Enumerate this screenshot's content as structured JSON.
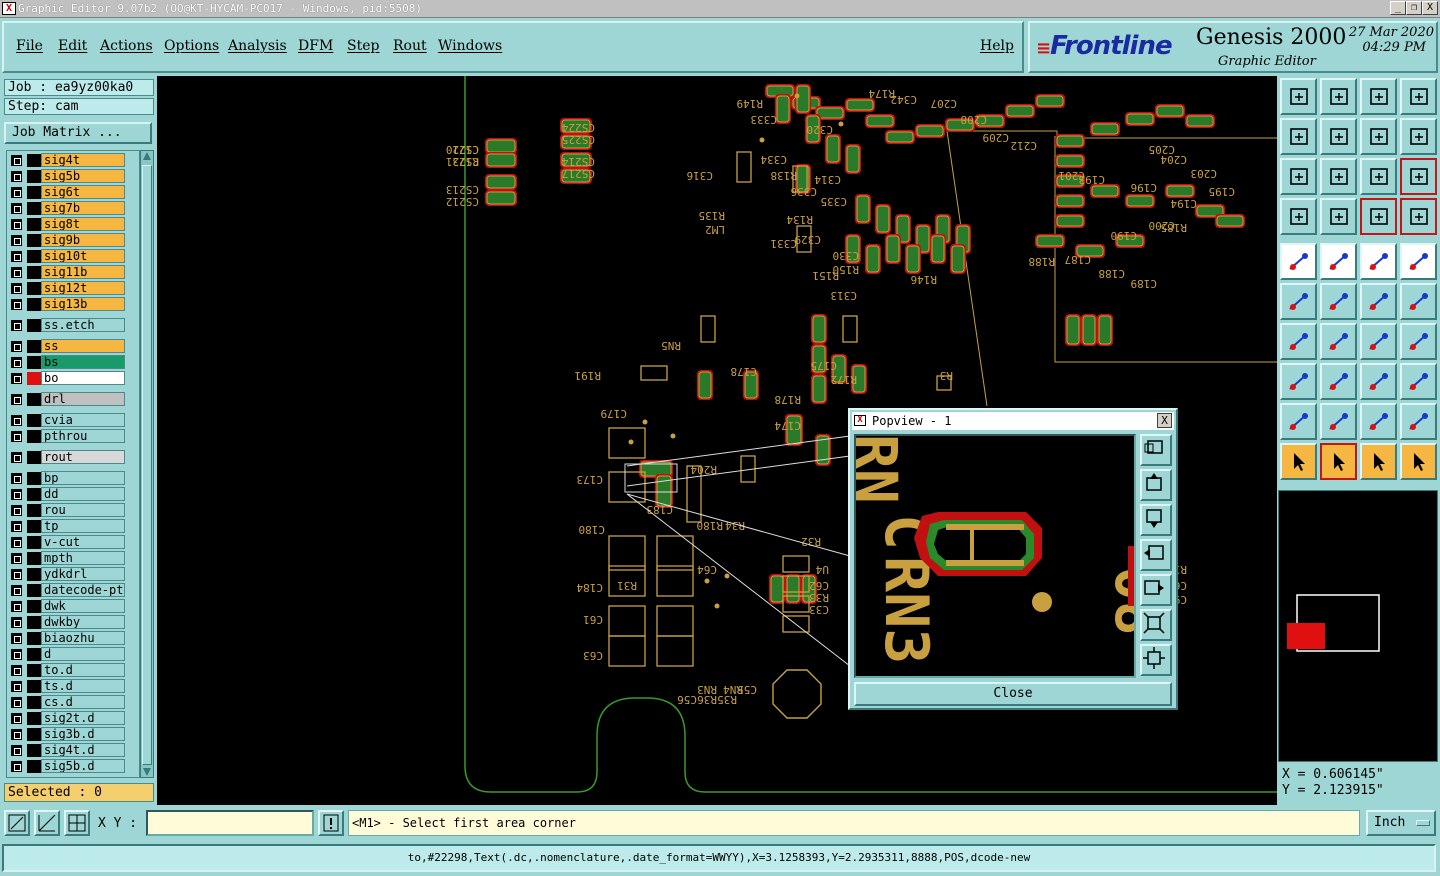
{
  "window": {
    "title": "Graphic Editor 9.07b2 (OO@KT-HYCAM-PC017 - Windows, pid:5508)",
    "buttons": [
      "_",
      "❐",
      "X"
    ]
  },
  "menu": {
    "items": [
      "File",
      "Edit",
      "Actions",
      "Options",
      "Analysis",
      "DFM",
      "Step",
      "Rout",
      "Windows"
    ],
    "help": "Help"
  },
  "brand": {
    "logo": "Frontline",
    "product": "Genesis 2000",
    "subtitle": "Graphic Editor",
    "date": "27 Mar 2020",
    "time": "04:29 PM"
  },
  "job": {
    "job_label": "Job : ea9yz00ka0",
    "step_label": "Step: cam",
    "matrix_button": "Job Matrix ..."
  },
  "layers": [
    {
      "name": "sig4t",
      "color": "#f5b642",
      "gap": 0
    },
    {
      "name": "sig5b",
      "color": "#f5b642",
      "gap": 0
    },
    {
      "name": "sig6t",
      "color": "#f5b642",
      "gap": 0
    },
    {
      "name": "sig7b",
      "color": "#f5b642",
      "gap": 0
    },
    {
      "name": "sig8t",
      "color": "#f5b642",
      "gap": 0
    },
    {
      "name": "sig9b",
      "color": "#f5b642",
      "gap": 0
    },
    {
      "name": "sig10t",
      "color": "#f5b642",
      "gap": 0
    },
    {
      "name": "sig11b",
      "color": "#f5b642",
      "gap": 0
    },
    {
      "name": "sig12t",
      "color": "#f5b642",
      "gap": 0
    },
    {
      "name": "sig13b",
      "color": "#f5b642",
      "gap": 0
    },
    {
      "name": "ss.etch",
      "color": "#9ed6d6",
      "gap": 1
    },
    {
      "name": "ss",
      "color": "#f5b642",
      "gap": 1
    },
    {
      "name": "bs",
      "color": "#1a9a6a",
      "gap": 0
    },
    {
      "name": "bo",
      "color": "#ffffff",
      "gap": 0,
      "swatch": "#e01010"
    },
    {
      "name": "drl",
      "color": "#c0c0c0",
      "gap": 1
    },
    {
      "name": "cvia",
      "color": "#9ed6d6",
      "gap": 1
    },
    {
      "name": "pthrou",
      "color": "#9ed6d6",
      "gap": 0
    },
    {
      "name": "rout",
      "color": "#d8d8d8",
      "gap": 1
    },
    {
      "name": "bp",
      "color": "#9ed6d6",
      "gap": 1
    },
    {
      "name": "dd",
      "color": "#9ed6d6",
      "gap": 0
    },
    {
      "name": "rou",
      "color": "#9ed6d6",
      "gap": 0
    },
    {
      "name": "tp",
      "color": "#9ed6d6",
      "gap": 0
    },
    {
      "name": "v-cut",
      "color": "#9ed6d6",
      "gap": 0
    },
    {
      "name": "mpth",
      "color": "#9ed6d6",
      "gap": 0
    },
    {
      "name": "ydkdrl",
      "color": "#9ed6d6",
      "gap": 0
    },
    {
      "name": "datecode-pt",
      "color": "#9ed6d6",
      "gap": 0
    },
    {
      "name": "dwk",
      "color": "#9ed6d6",
      "gap": 0
    },
    {
      "name": "dwkby",
      "color": "#9ed6d6",
      "gap": 0
    },
    {
      "name": "biaozhu",
      "color": "#9ed6d6",
      "gap": 0
    },
    {
      "name": "d",
      "color": "#9ed6d6",
      "gap": 0
    },
    {
      "name": "to.d",
      "color": "#9ed6d6",
      "gap": 0
    },
    {
      "name": "ts.d",
      "color": "#9ed6d6",
      "gap": 0
    },
    {
      "name": "cs.d",
      "color": "#9ed6d6",
      "gap": 0
    },
    {
      "name": "sig2t.d",
      "color": "#9ed6d6",
      "gap": 0
    },
    {
      "name": "sig3b.d",
      "color": "#9ed6d6",
      "gap": 0
    },
    {
      "name": "sig4t.d",
      "color": "#9ed6d6",
      "gap": 0
    },
    {
      "name": "sig5b.d",
      "color": "#9ed6d6",
      "gap": 0
    }
  ],
  "selected": "Selected : 0",
  "coords": {
    "x": "X = 0.606145\"",
    "y": "Y = 2.123915\""
  },
  "bottom": {
    "xy_label": "X Y :",
    "xy_value": "",
    "prompt": "<M1> - Select first area corner",
    "units": "Inch",
    "status": "to,#22298,Text(.dc,.nomenclature,.date_format=WWYY),X=3.1258393,Y=2.2935311,8888,POS,dcode-new"
  },
  "popview": {
    "title": "Popview - 1",
    "close": "Close",
    "close_x": "X"
  },
  "board_labels": [
    "CS220",
    "CS221",
    "CS224",
    "CS225",
    "CS214",
    "CS217",
    "CS213",
    "CS212",
    "C316",
    "R135",
    "LM2",
    "R134",
    "C331",
    "C329",
    "C330",
    "R150",
    "R151",
    "R149",
    "C333",
    "C334",
    "R138",
    "C336",
    "C335",
    "C320",
    "C314",
    "C313",
    "R146",
    "R174",
    "C342",
    "C207",
    "C208",
    "C209",
    "C212",
    "C205",
    "C204",
    "C203",
    "C195",
    "C194",
    "C200",
    "C201",
    "C193",
    "C196",
    "R185",
    "R188",
    "C187",
    "C188",
    "C189",
    "C190",
    "R191",
    "C179",
    "RN5",
    "C178",
    "R178",
    "R172",
    "C175",
    "C174",
    "C173",
    "C183",
    "R180",
    "C180",
    "C184",
    "C61",
    "C63",
    "C64",
    "U4",
    "C62",
    "R33",
    "C33",
    "R32",
    "R31",
    "RN3",
    "RN4",
    "C55",
    "C56",
    "R36",
    "R35",
    "R34",
    "R13",
    "C60",
    "C9",
    "R3",
    "R204",
    "C171",
    "R173"
  ]
}
